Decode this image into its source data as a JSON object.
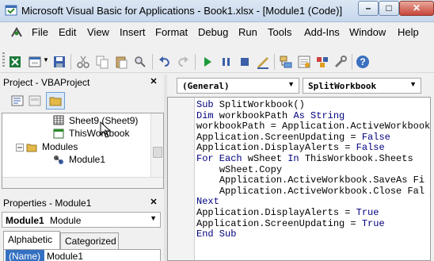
{
  "window": {
    "title": "Microsoft Visual Basic for Applications - Book1.xlsx - [Module1 (Code)]",
    "controls": {
      "minimize": "–",
      "maximize": "□",
      "close": "✕"
    }
  },
  "menu": {
    "items": [
      "File",
      "Edit",
      "View",
      "Insert",
      "Format",
      "Debug",
      "Run",
      "Tools",
      "Add-Ins",
      "Window",
      "Help"
    ]
  },
  "toolbar": {
    "icons": [
      "view-excel-icon",
      "insert-userform-icon",
      "save-icon",
      "cut-icon",
      "copy-icon",
      "paste-icon",
      "find-icon",
      "undo-icon",
      "redo-icon",
      "run-icon",
      "break-icon",
      "reset-icon",
      "design-mode-icon",
      "project-explorer-icon",
      "properties-window-icon",
      "object-browser-icon",
      "toolbox-icon",
      "help-icon"
    ]
  },
  "project_panel": {
    "title": "Project - VBAProject",
    "tree": [
      {
        "label": "Sheet9 (Sheet9)",
        "icon": "worksheet-icon"
      },
      {
        "label": "ThisWorkbook",
        "icon": "workbook-icon"
      },
      {
        "label": "Modules",
        "icon": "folder-icon"
      },
      {
        "label": "Module1",
        "icon": "module-icon"
      }
    ]
  },
  "properties_panel": {
    "title": "Properties - Module1",
    "object_name": "Module1",
    "object_type": "Module",
    "tabs": [
      "Alphabetic",
      "Categorized"
    ],
    "rows": [
      {
        "name": "(Name)",
        "value": "Module1"
      }
    ]
  },
  "code_window": {
    "object_dropdown": "(General)",
    "procedure_dropdown": "SplitWorkbook",
    "lines": [
      {
        "pre": "",
        "kw": "Sub",
        "rest": " SplitWorkbook()",
        "indent": 0
      },
      {
        "pre": "",
        "kw": "Dim",
        "rest": " workbookPath ",
        "kw2": "As String",
        "indent": 0
      },
      {
        "pre": "",
        "kw": "",
        "rest": "workbookPath = Application.ActiveWorkbook",
        "indent": 0
      },
      {
        "pre": "",
        "kw": "",
        "rest": "Application.ScreenUpdating = ",
        "kw2": "False",
        "indent": 0
      },
      {
        "pre": "",
        "kw": "",
        "rest": "Application.DisplayAlerts = ",
        "kw2": "False",
        "indent": 0
      },
      {
        "pre": "",
        "kw": "For Each",
        "rest": " wSheet ",
        "kw2": "In",
        "rest2": " ThisWorkbook.Sheets",
        "indent": 0
      },
      {
        "pre": "",
        "kw": "",
        "rest": "wSheet.Copy",
        "indent": 1
      },
      {
        "pre": "",
        "kw": "",
        "rest": "Application.ActiveWorkbook.SaveAs Fi",
        "indent": 1
      },
      {
        "pre": "",
        "kw": "",
        "rest": "Application.ActiveWorkbook.Close Fal",
        "indent": 1
      },
      {
        "pre": "",
        "kw": "Next",
        "rest": "",
        "indent": 0
      },
      {
        "pre": "",
        "kw": "",
        "rest": "Application.DisplayAlerts = ",
        "kw2": "True",
        "indent": 0
      },
      {
        "pre": "",
        "kw": "",
        "rest": "Application.ScreenUpdating = ",
        "kw2": "True",
        "indent": 0
      },
      {
        "pre": "",
        "kw": "End Sub",
        "rest": "",
        "indent": 0
      }
    ]
  },
  "colors": {
    "keyword": "#00007f",
    "titlebar": "#c7d8ec",
    "close_button": "#c7443a"
  }
}
